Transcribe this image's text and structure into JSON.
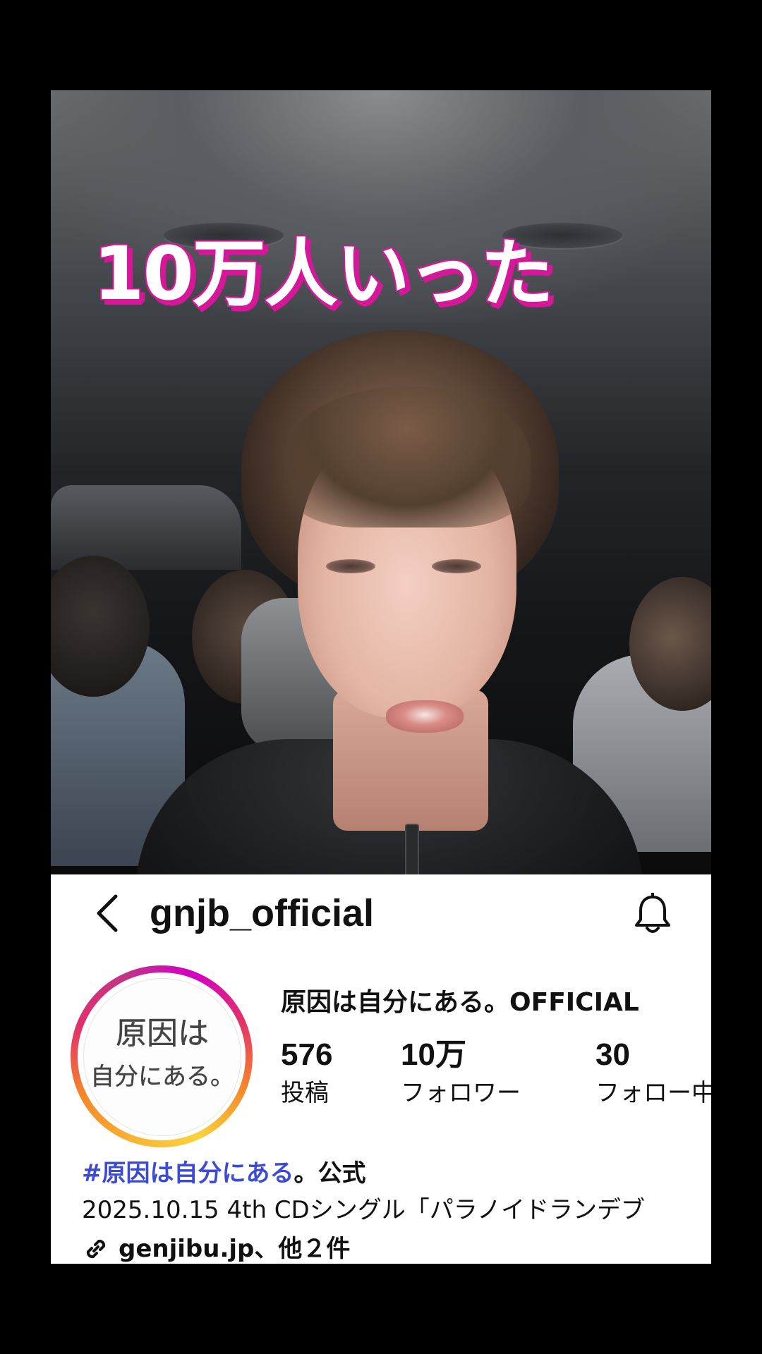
{
  "video": {
    "overlay_caption": "10万人いった"
  },
  "profile": {
    "username": "gnjb_official",
    "display_name": "原因は自分にある。OFFICIAL",
    "avatar_text_line1": "原因は",
    "avatar_text_line2": "自分にある。",
    "stats": [
      {
        "value": "576",
        "label": "投稿"
      },
      {
        "value": "10万",
        "label": "フォロワー"
      },
      {
        "value": "30",
        "label": "フォロー中"
      }
    ],
    "bio": {
      "hashtag": "#原因は自分にある",
      "hashtag_suffix": "。公式",
      "line2": "2025.10.15 4th CDシングル「パラノイドランデブ"
    },
    "link": "genjibu.jp、他２件"
  },
  "colors": {
    "caption_shadow": "#d6179a",
    "hashtag": "#3b4bd3",
    "ring_gradient": [
      "#f9b233",
      "#f58529",
      "#e1306c",
      "#c13584",
      "#d300c5"
    ]
  },
  "icons": {
    "back": "chevron-left-icon",
    "notifications": "bell-icon",
    "link": "link-icon"
  }
}
